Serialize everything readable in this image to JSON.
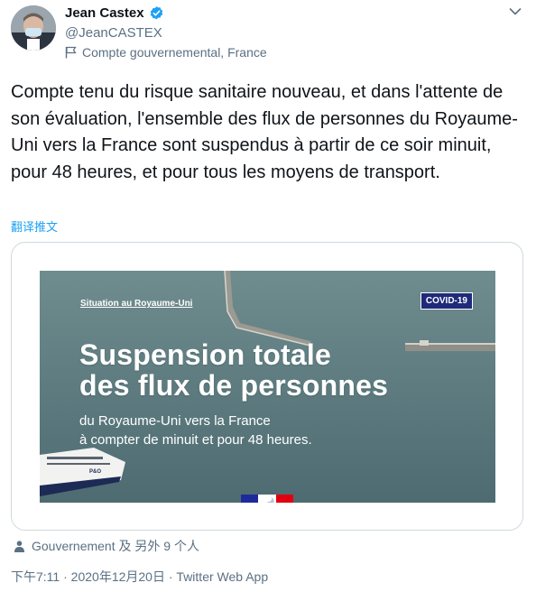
{
  "author": {
    "name": "Jean Castex",
    "handle": "@JeanCASTEX",
    "label": "Compte gouvernemental, France"
  },
  "tweet": {
    "text": "Compte tenu du risque sanitaire nouveau, et dans l'attente de son évaluation, l'ensemble des flux de personnes du Royaume-Uni vers la France sont suspendus à partir de ce soir minuit, pour 48 heures, et pour tous les moyens de transport.",
    "translate_label": "翻译推文"
  },
  "media": {
    "kicker": "Situation au Royaume-Uni",
    "badge": "COVID-19",
    "headline_line1": "Suspension totale",
    "headline_line2": "des flux de personnes",
    "sub_line1": "du Royaume-Uni vers la France",
    "sub_line2": "à compter de minuit et pour 48 heures.",
    "ship_text": "P&O"
  },
  "social_context": {
    "text": "Gouvernement 及 另外 9 个人",
    "icon": "user-icon"
  },
  "meta": {
    "time": "下午7:11",
    "date": "2020年12月20日",
    "separator": " · ",
    "source": "Twitter Web App"
  },
  "colors": {
    "verified": "#1da1f2",
    "link": "#1da1f2",
    "secondary_text": "#5b7083",
    "badge_bg": "#1f2a7a"
  }
}
